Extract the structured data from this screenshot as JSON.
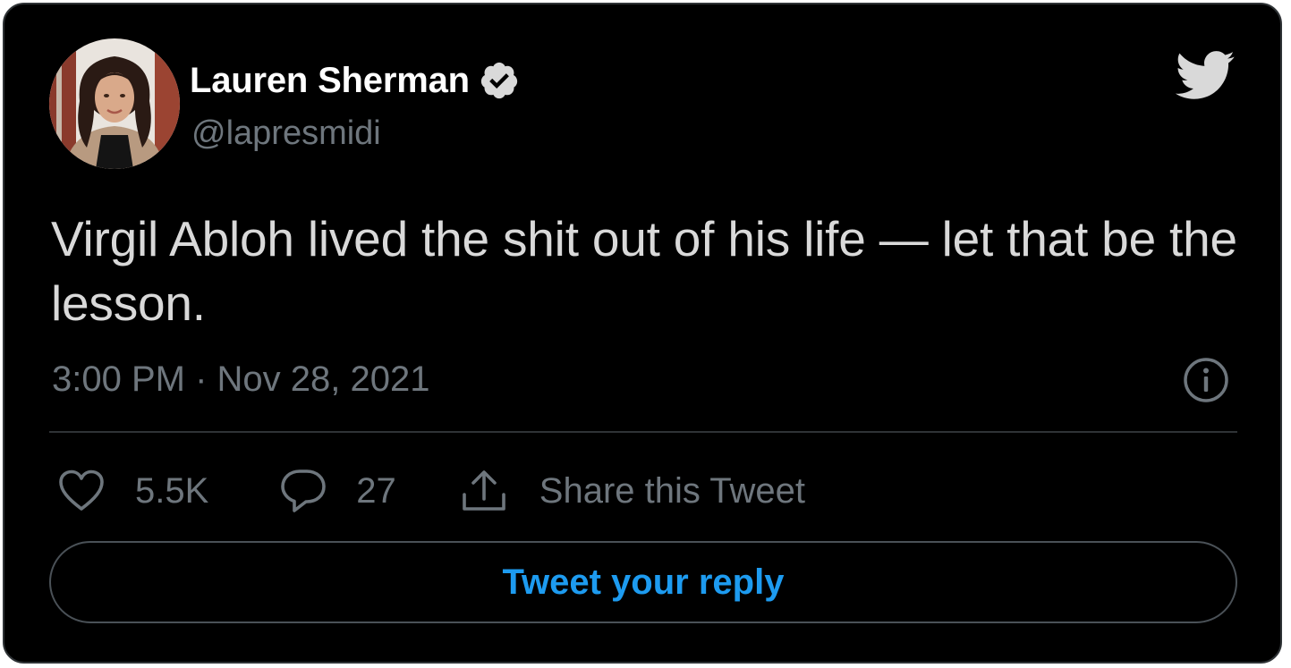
{
  "author": {
    "name": "Lauren Sherman",
    "handle": "@lapresmidi",
    "verified": true,
    "avatar": "avatar-photo"
  },
  "brand": {
    "logo_icon": "twitter-bird-icon",
    "accent_color": "#1d9bf0",
    "logo_color": "#d9d9d9"
  },
  "tweet": {
    "text": "Virgil Abloh lived the shit out of his life — let that be the lesson.",
    "timestamp": "3:00 PM · Nov 28, 2021"
  },
  "actions": {
    "like_icon": "heart-icon",
    "like_count": "5.5K",
    "reply_icon": "speech-bubble-icon",
    "reply_count": "27",
    "share_icon": "share-upload-icon",
    "share_label": "Share this Tweet",
    "info_icon": "info-icon"
  },
  "reply_button": {
    "label": "Tweet your reply"
  },
  "colors": {
    "background": "#000000",
    "text_primary": "#d9d9d9",
    "text_secondary": "#6e767d",
    "border": "#2f3336"
  }
}
